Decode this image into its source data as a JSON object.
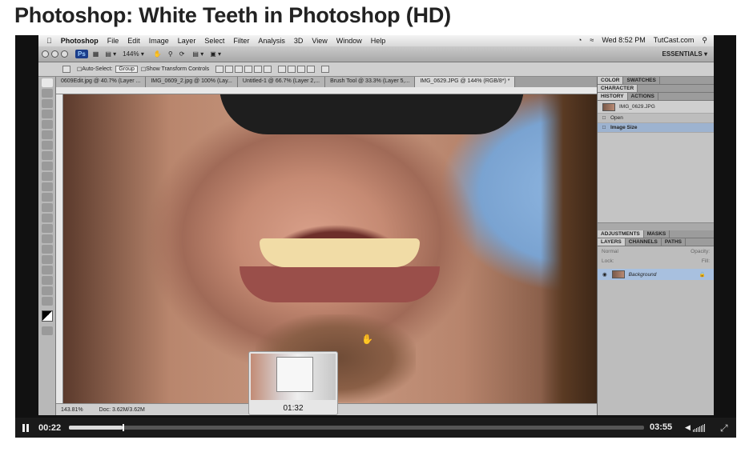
{
  "page": {
    "title": "Photoshop: White Teeth in Photoshop (HD)"
  },
  "menubar": {
    "apple": "",
    "items": [
      "Photoshop",
      "File",
      "Edit",
      "Image",
      "Layer",
      "Select",
      "Filter",
      "Analysis",
      "3D",
      "View",
      "Window",
      "Help"
    ],
    "clock": "Wed 8:52 PM",
    "site": "TutCast.com"
  },
  "appbar": {
    "ps_badge": "Ps",
    "zoom": "144%",
    "workspace": "ESSENTIALS ▾"
  },
  "options": {
    "auto_select": "Auto-Select:",
    "group": "Group",
    "transform": "Show Transform Controls"
  },
  "tabs": [
    {
      "label": "0609Edit.jpg @ 40.7% (Layer ...",
      "active": false
    },
    {
      "label": "IMG_0609_2.jpg @ 100% (Lay...",
      "active": false
    },
    {
      "label": "Untitled-1 @ 66.7% (Layer 2,...",
      "active": false
    },
    {
      "label": "Brush Tool @ 33.3% (Layer 5,...",
      "active": false
    },
    {
      "label": "IMG_0629.JPG @ 144% (RGB/8*) *",
      "active": true
    }
  ],
  "panels": {
    "top_tabs": [
      "COLOR",
      "SWATCHES"
    ],
    "character": "CHARACTER",
    "history_tabs": [
      "HISTORY",
      "ACTIONS"
    ],
    "history_file": "IMG_0629.JPG",
    "history_items": [
      "Open",
      "Image Size"
    ],
    "adjust_tabs": [
      "ADJUSTMENTS",
      "MASKS"
    ],
    "layer_tabs": [
      "LAYERS",
      "CHANNELS",
      "PATHS"
    ],
    "blend": "Normal",
    "opacity": "Opacity:",
    "lock": "Lock:",
    "fill": "Fill:",
    "layer_name": "Background"
  },
  "status": {
    "zoom": "143.81%",
    "doc": "Doc: 3.62M/3.62M"
  },
  "player": {
    "preview_time": "01:32",
    "elapsed": "00:22",
    "duration": "03:55",
    "progress": 0.094
  }
}
